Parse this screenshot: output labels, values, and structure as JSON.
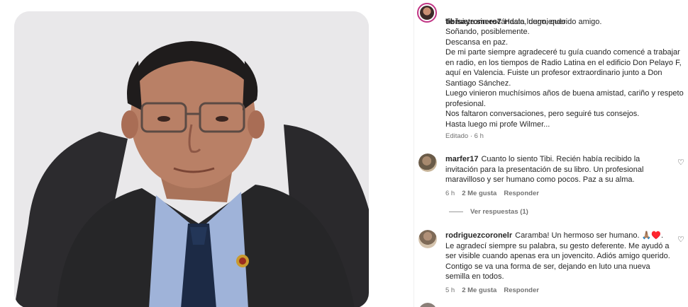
{
  "post": {
    "username": "tibisayromero7",
    "caption_lines": [
      "Hasta luego, querido amigo.",
      "Te fuiste sin escándalo, durmiendo.",
      "Soñando, posiblemente.",
      "Descansa en paz.",
      "De mi parte siempre agradeceré tu guía cuando comencé a trabajar en radio, en los tiempos de Radio Latina en el edificio Don Pelayo F, aquí en Valencia. Fuiste un profesor extraordinario junto a Don Santiago Sánchez.",
      "Luego vinieron muchísimos años de buena amistad, cariño y respeto profesional.",
      "Nos faltaron conversaciones, pero seguiré tus consejos.",
      "Hasta luego mi profe Wilmer..."
    ],
    "edited_label": "Editado · 6 h"
  },
  "comments": [
    {
      "username": "marfer17",
      "text": "Cuanto lo siento Tibi. Recién había recibido la invitación para la presentación de su libro. Un profesional maravilloso y ser humano como pocos. Paz a su alma.",
      "time": "6 h",
      "likes": "2 Me gusta",
      "reply_label": "Responder",
      "view_replies": "Ver respuestas (1)"
    },
    {
      "username": "rodriguezcoronelr",
      "text": "Caramba! Un hermoso ser humano. 🙏🏽♥️. Le agradecí siempre su palabra, su gesto deferente. Me ayudó a ser visible cuando apenas era un jovencito. Adiós amigo querido. Contigo se va una forma de ser, dejando en luto una nueva semilla en todos.",
      "time": "5 h",
      "likes": "2 Me gusta",
      "reply_label": "Responder"
    }
  ],
  "icons": {
    "like": "heart-outline-icon"
  },
  "colors": {
    "text": "#262626",
    "muted": "#737373",
    "story_ring": "#c13584"
  }
}
